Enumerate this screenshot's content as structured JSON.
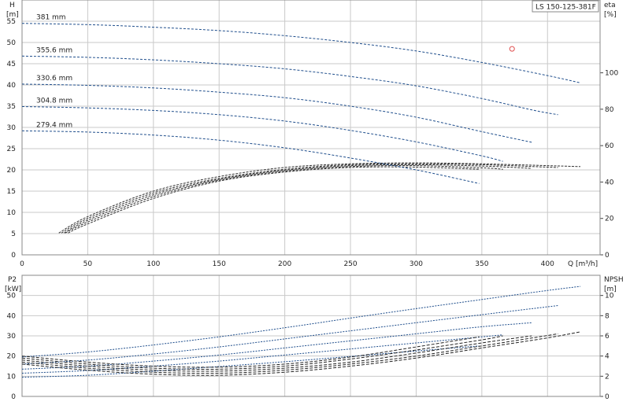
{
  "chart_data": [
    {
      "type": "line",
      "title": "LS 150-125-381F",
      "xlabel": "Q [m³/h]",
      "ylabel_left_name": "H",
      "ylabel_left_unit": "[m]",
      "ylabel_right_name": "eta",
      "ylabel_right_unit": "[%]",
      "xlim": [
        0,
        440
      ],
      "ylim": [
        0,
        60
      ],
      "y2lim": [
        0,
        140
      ],
      "xticks": [
        "0",
        "50",
        "100",
        "150",
        "200",
        "250",
        "300",
        "350",
        "400"
      ],
      "yticks": [
        "0",
        "5",
        "10",
        "15",
        "20",
        "25",
        "30",
        "35",
        "40",
        "45",
        "50",
        "55"
      ],
      "y2ticks": [
        "0",
        "20",
        "40",
        "60",
        "80",
        "100"
      ],
      "grid": true,
      "series": [
        {
          "name": "381 mm",
          "color": "#1f4e8c",
          "x": [
            0,
            50,
            100,
            150,
            200,
            250,
            300,
            350,
            400,
            425
          ],
          "y": [
            54.5,
            54.2,
            53.6,
            52.8,
            51.6,
            50.0,
            48.0,
            45.3,
            42.2,
            40.5
          ]
        },
        {
          "name": "355.6 mm",
          "color": "#1f4e8c",
          "x": [
            0,
            50,
            100,
            150,
            200,
            250,
            300,
            350,
            390,
            408
          ],
          "y": [
            46.8,
            46.5,
            45.9,
            45.0,
            43.8,
            42.0,
            39.8,
            36.8,
            34.0,
            33.0
          ]
        },
        {
          "name": "330.6 mm",
          "color": "#1f4e8c",
          "x": [
            0,
            50,
            100,
            150,
            200,
            250,
            300,
            350,
            388
          ],
          "y": [
            40.2,
            39.9,
            39.3,
            38.3,
            37.0,
            35.0,
            32.4,
            29.0,
            26.5
          ]
        },
        {
          "name": "304.8 mm",
          "color": "#1f4e8c",
          "x": [
            0,
            50,
            100,
            150,
            200,
            250,
            300,
            350,
            366
          ],
          "y": [
            34.9,
            34.6,
            34.0,
            33.0,
            31.5,
            29.3,
            26.6,
            23.3,
            22.0
          ]
        },
        {
          "name": "279.4 mm",
          "color": "#1f4e8c",
          "x": [
            0,
            50,
            100,
            150,
            200,
            250,
            300,
            348
          ],
          "y": [
            29.2,
            28.9,
            28.2,
            27.0,
            25.2,
            22.8,
            20.0,
            16.8
          ]
        }
      ],
      "efficiency_series": [
        {
          "color": "#333333",
          "x": [
            28,
            50,
            100,
            150,
            200,
            250,
            300,
            350,
            400,
            425
          ],
          "y": [
            12,
            21,
            35,
            43,
            48,
            50,
            50.5,
            50,
            49,
            48.5
          ]
        },
        {
          "color": "#333333",
          "x": [
            30,
            50,
            100,
            150,
            200,
            250,
            300,
            350,
            400,
            408
          ],
          "y": [
            12,
            20,
            34,
            42,
            47,
            49.5,
            50,
            49.5,
            48.2,
            48
          ]
        },
        {
          "color": "#333333",
          "x": [
            32,
            50,
            100,
            150,
            200,
            250,
            300,
            350,
            388
          ],
          "y": [
            12,
            19,
            33,
            41.5,
            46.5,
            49,
            49.5,
            48.8,
            47.5
          ]
        },
        {
          "color": "#333333",
          "x": [
            33,
            50,
            100,
            150,
            200,
            250,
            300,
            350,
            366
          ],
          "y": [
            12,
            18,
            32,
            41,
            46,
            48.5,
            49,
            47.8,
            47
          ]
        },
        {
          "color": "#333333",
          "x": [
            35,
            50,
            100,
            150,
            200,
            250,
            300,
            348
          ],
          "y": [
            12,
            17,
            31,
            40.5,
            45.5,
            48,
            48.2,
            47
          ]
        }
      ],
      "duty_point": {
        "x": 373,
        "y": 48.5,
        "color": "#e05050"
      }
    },
    {
      "type": "line",
      "ylabel_left_name": "P2",
      "ylabel_left_unit": "[kW]",
      "ylabel_right_name": "NPSH",
      "ylabel_right_unit": "[m]",
      "xlim": [
        0,
        440
      ],
      "ylim": [
        0,
        60
      ],
      "y2lim": [
        0,
        12
      ],
      "yticks": [
        "0",
        "10",
        "20",
        "30",
        "40",
        "50"
      ],
      "y2ticks": [
        "0",
        "2",
        "4",
        "6",
        "8",
        "10"
      ],
      "grid": true,
      "power_series": [
        {
          "color": "#1f4e8c",
          "x": [
            0,
            50,
            100,
            150,
            200,
            250,
            300,
            350,
            400,
            425
          ],
          "y": [
            19.5,
            22,
            25.5,
            29.5,
            34,
            38.8,
            43.5,
            48,
            52.5,
            54.5
          ]
        },
        {
          "color": "#1f4e8c",
          "x": [
            0,
            50,
            100,
            150,
            200,
            250,
            300,
            350,
            408
          ],
          "y": [
            16,
            18,
            21,
            24.5,
            28.5,
            32.5,
            36.5,
            40.5,
            45
          ]
        },
        {
          "color": "#1f4e8c",
          "x": [
            0,
            50,
            100,
            150,
            200,
            250,
            300,
            350,
            388
          ],
          "y": [
            13.5,
            15,
            17.5,
            20.5,
            24,
            27.5,
            31,
            34.5,
            36.5
          ]
        },
        {
          "color": "#1f4e8c",
          "x": [
            0,
            50,
            100,
            150,
            200,
            250,
            300,
            350,
            366
          ],
          "y": [
            11.5,
            12.8,
            15,
            17.5,
            20.5,
            23.5,
            26.5,
            29.5,
            30.5
          ]
        },
        {
          "color": "#1f4e8c",
          "x": [
            0,
            50,
            100,
            150,
            200,
            250,
            300,
            348
          ],
          "y": [
            9.5,
            10.5,
            12.5,
            14.8,
            17.2,
            19.8,
            22.5,
            25
          ]
        }
      ],
      "npsh_series": [
        {
          "color": "#222222",
          "x": [
            0,
            50,
            100,
            150,
            200,
            250,
            300,
            350,
            400,
            425
          ],
          "y": [
            3.2,
            2.6,
            2.2,
            2.1,
            2.4,
            3.0,
            3.8,
            4.8,
            5.8,
            6.4
          ]
        },
        {
          "color": "#222222",
          "x": [
            0,
            50,
            100,
            150,
            200,
            250,
            300,
            350,
            408
          ],
          "y": [
            3.4,
            2.8,
            2.4,
            2.3,
            2.6,
            3.2,
            4.0,
            5.0,
            6.2
          ]
        },
        {
          "color": "#222222",
          "x": [
            0,
            50,
            100,
            150,
            200,
            250,
            300,
            350,
            388
          ],
          "y": [
            3.6,
            3.0,
            2.6,
            2.5,
            2.8,
            3.4,
            4.3,
            5.3,
            6.0
          ]
        },
        {
          "color": "#222222",
          "x": [
            0,
            50,
            100,
            150,
            200,
            250,
            300,
            350,
            366
          ],
          "y": [
            3.8,
            3.2,
            2.8,
            2.7,
            3.0,
            3.7,
            4.6,
            5.6,
            6.0
          ]
        },
        {
          "color": "#222222",
          "x": [
            0,
            50,
            100,
            150,
            200,
            250,
            300,
            348
          ],
          "y": [
            4.0,
            3.4,
            3.0,
            2.9,
            3.2,
            3.9,
            4.9,
            5.9
          ]
        }
      ]
    }
  ]
}
